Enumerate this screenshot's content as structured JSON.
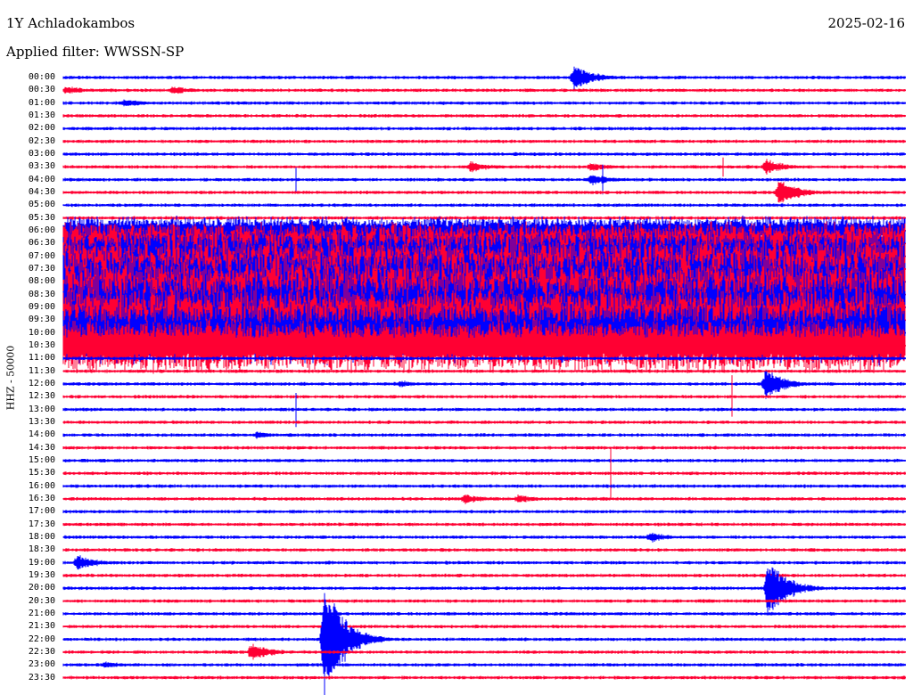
{
  "station": "1Y Achladokambos",
  "date": "2025-02-16",
  "filter": "Applied filter: WWSSN-SP",
  "chart_data": {
    "type": "helicorder",
    "title": "1Y Achladokambos",
    "ylabel": "HHZ - 50000",
    "row_interval_minutes": 30,
    "colors": [
      "#0000ff",
      "#ff0033"
    ],
    "grid": false,
    "y_ticks": [
      "00:00",
      "00:30",
      "01:00",
      "01:30",
      "02:00",
      "02:30",
      "03:00",
      "03:30",
      "04:00",
      "04:30",
      "05:00",
      "05:30",
      "06:00",
      "06:30",
      "07:00",
      "07:30",
      "08:00",
      "08:30",
      "09:00",
      "09:30",
      "10:00",
      "10:30",
      "11:00",
      "11:30",
      "12:00",
      "12:30",
      "13:00",
      "13:30",
      "14:00",
      "14:30",
      "15:00",
      "15:30",
      "16:00",
      "16:30",
      "17:00",
      "17:30",
      "18:00",
      "18:30",
      "19:00",
      "19:30",
      "20:00",
      "20:30",
      "21:00",
      "21:30",
      "22:00",
      "22:30",
      "23:00",
      "23:30"
    ],
    "noise_level": [
      1.5,
      1.5,
      1.5,
      1.5,
      1.5,
      1.5,
      1.5,
      1.5,
      1.5,
      1.5,
      1.5,
      1.5,
      12,
      18,
      22,
      26,
      28,
      30,
      30,
      28,
      26,
      22,
      1.5,
      1.5,
      1.5,
      1.5,
      1.5,
      1.5,
      1.5,
      1.5,
      1.5,
      1.5,
      1.5,
      1.5,
      1.5,
      1.5,
      1.5,
      1.5,
      1.5,
      1.5,
      1.5,
      1.5,
      1.5,
      1.5,
      1.5,
      1.5,
      1.5,
      1.5
    ],
    "events": [
      {
        "trace": "00:00",
        "minute": 18.2,
        "amplitude": 14
      },
      {
        "trace": "00:30",
        "minute": 0.1,
        "amplitude": 5
      },
      {
        "trace": "00:30",
        "minute": 3.9,
        "amplitude": 5
      },
      {
        "trace": "01:00",
        "minute": 2.2,
        "amplitude": 5
      },
      {
        "trace": "03:30",
        "minute": 14.5,
        "amplitude": 6
      },
      {
        "trace": "03:30",
        "minute": 18.8,
        "amplitude": 5
      },
      {
        "trace": "03:30",
        "minute": 25.0,
        "amplitude": 8
      },
      {
        "trace": "04:00",
        "minute": 18.8,
        "amplitude": 7
      },
      {
        "trace": "04:30",
        "minute": 25.5,
        "amplitude": 14
      },
      {
        "trace": "12:00",
        "minute": 25.0,
        "amplitude": 16
      },
      {
        "trace": "12:00",
        "minute": 12.0,
        "amplitude": 4
      },
      {
        "trace": "14:00",
        "minute": 6.9,
        "amplitude": 4
      },
      {
        "trace": "16:30",
        "minute": 14.3,
        "amplitude": 6
      },
      {
        "trace": "16:30",
        "minute": 16.2,
        "amplitude": 5
      },
      {
        "trace": "18:00",
        "minute": 20.9,
        "amplitude": 6
      },
      {
        "trace": "19:00",
        "minute": 0.5,
        "amplitude": 9
      },
      {
        "trace": "20:00",
        "minute": 25.1,
        "amplitude": 30
      },
      {
        "trace": "22:00",
        "minute": 9.3,
        "amplitude": 60
      },
      {
        "trace": "22:30",
        "minute": 6.7,
        "amplitude": 10
      },
      {
        "trace": "23:00",
        "minute": 1.5,
        "amplitude": 4
      }
    ],
    "spikes": [
      {
        "trace": "04:00",
        "minute": 8.3,
        "amplitude": 16
      },
      {
        "trace": "13:00",
        "minute": 8.3,
        "amplitude": 24
      },
      {
        "trace": "15:30",
        "minute": 19.5,
        "amplitude": 40
      },
      {
        "trace": "12:30",
        "minute": 23.8,
        "amplitude": 30
      },
      {
        "trace": "03:30",
        "minute": 23.5,
        "amplitude": 14
      },
      {
        "trace": "04:00",
        "minute": 19.2,
        "amplitude": 22
      }
    ]
  }
}
